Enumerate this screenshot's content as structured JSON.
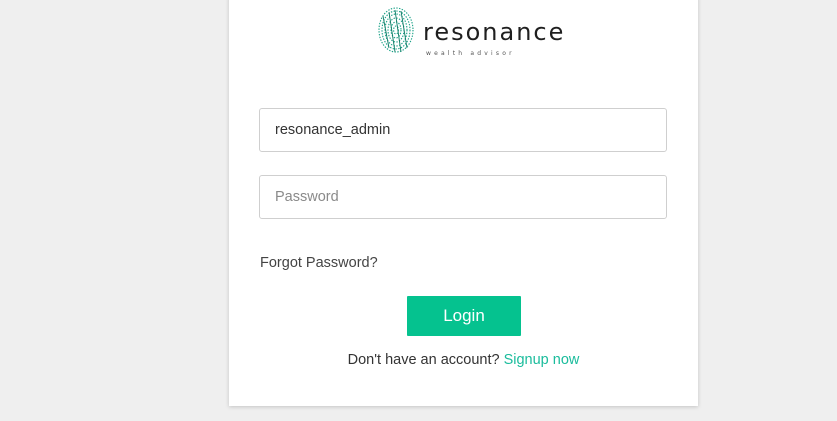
{
  "brand": {
    "name": "resonance",
    "tagline": "wealth advisor",
    "accent_color": "#05c28f",
    "logo_icon": "fingerprint-icon"
  },
  "login_form": {
    "username_value": "resonance_admin",
    "password_placeholder": "Password",
    "password_value": "",
    "forgot_password_label": "Forgot Password?",
    "login_label": "Login",
    "signup_prompt": "Don't have an account?",
    "signup_link_label": "Signup now"
  }
}
